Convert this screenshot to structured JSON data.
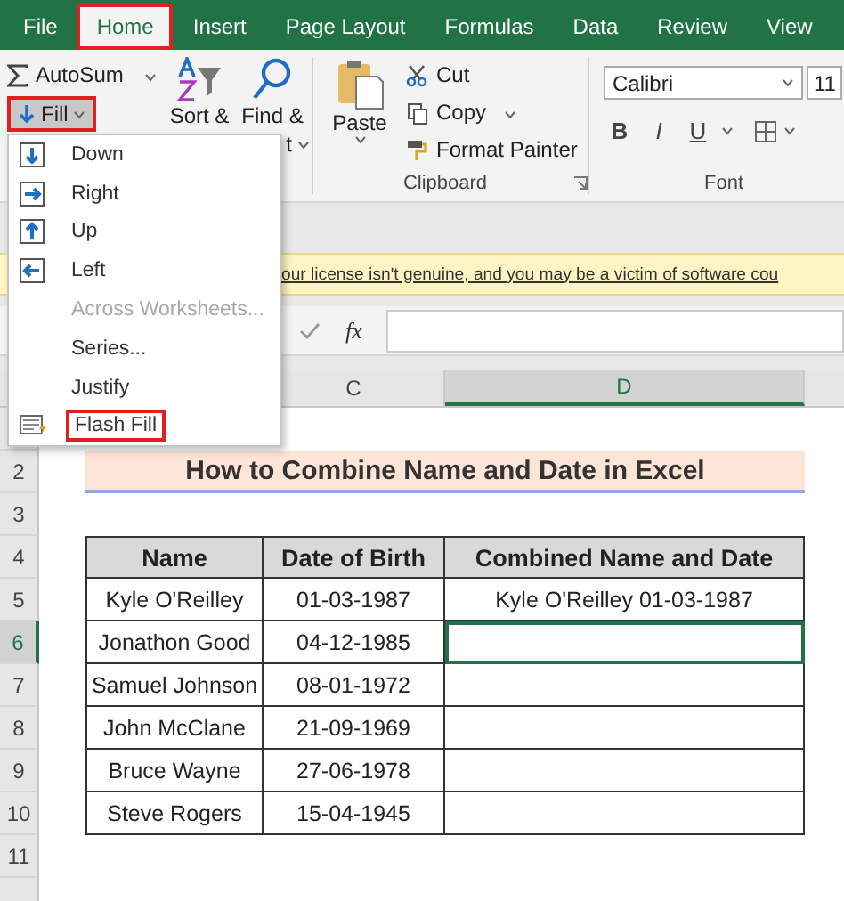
{
  "tabs": [
    {
      "label": "File",
      "selected": false,
      "highlighted": false
    },
    {
      "label": "Home",
      "selected": true,
      "highlighted": true
    },
    {
      "label": "Insert",
      "selected": false,
      "highlighted": false
    },
    {
      "label": "Page Layout",
      "selected": false,
      "highlighted": false
    },
    {
      "label": "Formulas",
      "selected": false,
      "highlighted": false
    },
    {
      "label": "Data",
      "selected": false,
      "highlighted": false
    },
    {
      "label": "Review",
      "selected": false,
      "highlighted": false
    },
    {
      "label": "View",
      "selected": false,
      "highlighted": false
    }
  ],
  "ribbon": {
    "editing": {
      "autosum": "AutoSum",
      "fill": {
        "label": "Fill",
        "highlighted": true
      },
      "sort": "Sort &",
      "find": "Find &",
      "find_rest": "t"
    },
    "clipboard": {
      "paste": "Paste",
      "items": [
        {
          "label": "Cut",
          "kind": "cut"
        },
        {
          "label": "Copy",
          "kind": "copy"
        },
        {
          "label": "Format Painter",
          "kind": "painter"
        }
      ],
      "label": "Clipboard"
    },
    "font": {
      "name": "Calibri",
      "size": "11",
      "buttons": [
        "B",
        "I",
        "U"
      ],
      "label": "Font"
    }
  },
  "fill_menu": {
    "items": [
      {
        "label": "Down",
        "kind": "down",
        "disabled": false,
        "highlighted": false
      },
      {
        "label": "Right",
        "kind": "right",
        "disabled": false,
        "highlighted": false
      },
      {
        "label": "Up",
        "kind": "up",
        "disabled": false,
        "highlighted": false
      },
      {
        "label": "Left",
        "kind": "left",
        "disabled": false,
        "highlighted": false
      },
      {
        "label": "Across Worksheets...",
        "kind": "plain",
        "disabled": true,
        "highlighted": false
      },
      {
        "label": "Series...",
        "kind": "plain",
        "disabled": false,
        "highlighted": false
      },
      {
        "label": "Justify",
        "kind": "plain",
        "disabled": false,
        "highlighted": false
      },
      {
        "label": "Flash Fill",
        "kind": "flash",
        "disabled": false,
        "highlighted": true
      }
    ]
  },
  "message_bar": {
    "text": "our license isn't genuine, and you may be a victim of software cou"
  },
  "formula_bar": {
    "fx": "fx"
  },
  "sheet": {
    "columns": [
      {
        "label": "C",
        "selected": false
      },
      {
        "label": "D",
        "selected": true
      }
    ],
    "row_numbers": [
      {
        "label": "2",
        "selected": false
      },
      {
        "label": "3",
        "selected": false
      },
      {
        "label": "4",
        "selected": false
      },
      {
        "label": "5",
        "selected": false
      },
      {
        "label": "6",
        "selected": true
      },
      {
        "label": "7",
        "selected": false
      },
      {
        "label": "8",
        "selected": false
      },
      {
        "label": "9",
        "selected": false
      },
      {
        "label": "10",
        "selected": false
      },
      {
        "label": "11",
        "selected": false
      }
    ],
    "title": "How to Combine Name and Date in Excel",
    "table": {
      "columns": [
        "Name",
        "Date of Birth",
        "Combined Name and Date"
      ],
      "rows": [
        {
          "name": "Kyle O'Reilley",
          "dob": "01-03-1987",
          "combined": "Kyle O'Reilley 01-03-1987",
          "selected": false
        },
        {
          "name": "Jonathon Good",
          "dob": "04-12-1985",
          "selected": true
        },
        {
          "name": "Samuel Johnson",
          "dob": "08-01-1972",
          "selected": false
        },
        {
          "name": "John McClane",
          "dob": "21-09-1969",
          "selected": false
        },
        {
          "name": "Bruce Wayne",
          "dob": "27-06-1978",
          "selected": false
        },
        {
          "name": "Steve Rogers",
          "dob": "15-04-1945",
          "selected": false
        }
      ]
    }
  }
}
